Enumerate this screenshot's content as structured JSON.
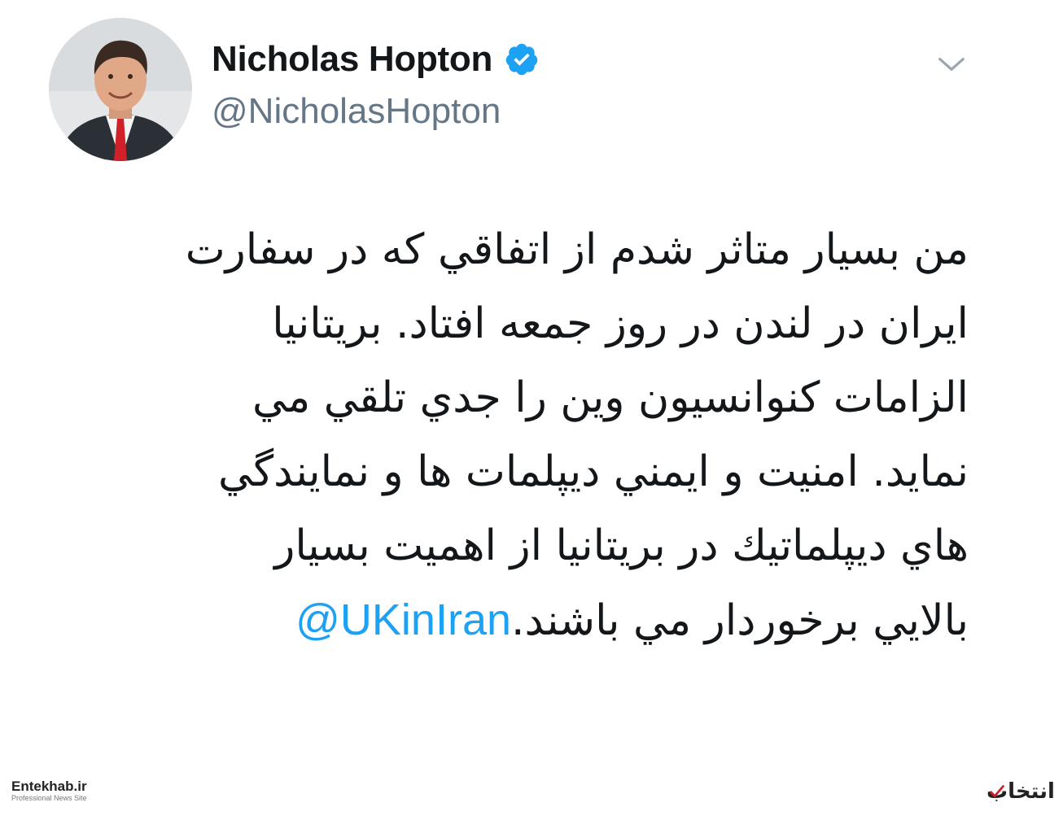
{
  "author": {
    "display_name": "Nicholas Hopton",
    "handle": "@NicholasHopton",
    "verified": true,
    "avatar_icon": "profile-photo"
  },
  "tweet": {
    "lines": [
      "من بسيار متاثر شدم از اتفاقي كه در سفارت",
      "ايران در لندن در روز جمعه افتاد. بريتانيا",
      "الزامات كنوانسيون وين را جدي تلقي مي",
      "نمايد. امنيت و ايمني ديپلمات ها و نمايندگي",
      "هاي ديپلماتيك در بريتانيا از اهميت بسيار",
      "بالايي برخوردار مي باشند."
    ],
    "mention": "@UKinIran"
  },
  "menu": {
    "icon": "chevron-down-icon"
  },
  "watermarks": {
    "left_brand": "Entekhab.ir",
    "left_sub": "Professional News Site",
    "right_brand": "انتخاب"
  },
  "colors": {
    "verified_blue": "#1da1f2",
    "mention_blue": "#1da1f2",
    "handle_grey": "#657786",
    "text": "#14171a"
  }
}
